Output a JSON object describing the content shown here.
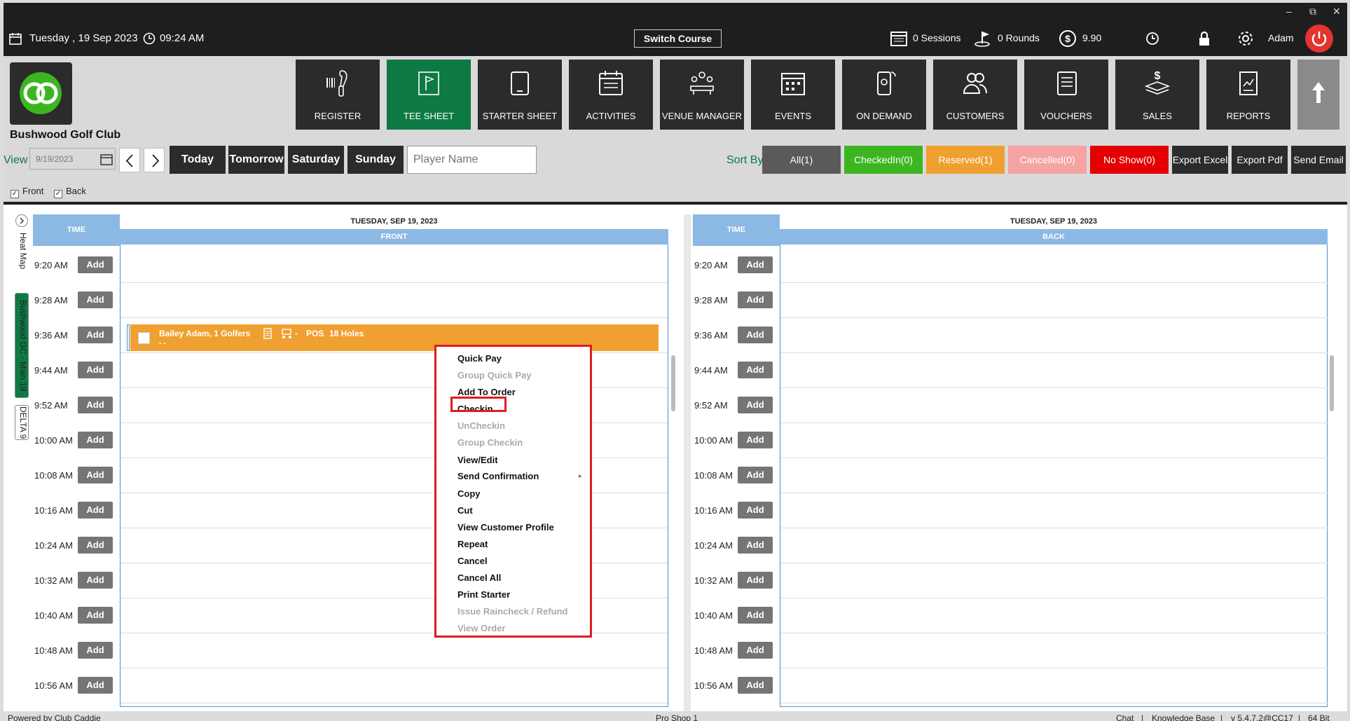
{
  "titlebar": {
    "date": "Tuesday ,  19 Sep 2023",
    "time": "09:24 AM",
    "switch_course": "Switch Course",
    "sessions": "0 Sessions",
    "rounds": "0 Rounds",
    "amount": "9.90",
    "user": "Adam",
    "win_min": "–",
    "win_max": "⧉",
    "win_close": "✕"
  },
  "club": {
    "name": "Bushwood Golf Club"
  },
  "nav": [
    {
      "label": "REGISTER",
      "icon": "barcode-scanner-icon"
    },
    {
      "label": "TEE SHEET",
      "icon": "flag-icon",
      "active": true
    },
    {
      "label": "STARTER SHEET",
      "icon": "tablet-icon"
    },
    {
      "label": "ACTIVITIES",
      "icon": "calendar-list-icon"
    },
    {
      "label": "VENUE MANAGER",
      "icon": "meeting-icon"
    },
    {
      "label": "EVENTS",
      "icon": "calendar-icon"
    },
    {
      "label": "ON DEMAND",
      "icon": "mobile-icon"
    },
    {
      "label": "CUSTOMERS",
      "icon": "people-icon"
    },
    {
      "label": "VOUCHERS",
      "icon": "voucher-icon"
    },
    {
      "label": "SALES",
      "icon": "money-icon"
    },
    {
      "label": "REPORTS",
      "icon": "report-icon"
    }
  ],
  "toolbar": {
    "view_label": "View",
    "date_value": "9/19/2023",
    "today": "Today",
    "tomorrow": "Tomorrow",
    "saturday": "Saturday",
    "sunday": "Sunday",
    "player_placeholder": "Player Name",
    "sort_by": "Sort By",
    "all": "All(1)",
    "checkedin": "CheckedIn(0)",
    "reserved": "Reserved(1)",
    "cancelled": "Cancelled(0)",
    "noshow": "No Show(0)",
    "export_excel": "Export Excel",
    "export_pdf": "Export Pdf",
    "send_email": "Send Email",
    "front": "Front",
    "back": "Back",
    "status_colors": {
      "all": "#5a5a5a",
      "checkedin": "#3cb521",
      "reserved": "#f0a030",
      "cancelled": "#f5a3a3",
      "noshow": "#e40000"
    }
  },
  "side_tabs": {
    "heat_map": "Heat Map",
    "course1": "Bushwood GC - Main 18",
    "course2": "DELTA 9"
  },
  "grid": {
    "time_header": "TIME",
    "date_header": "TUESDAY, SEP 19, 2023",
    "front": "FRONT",
    "back": "BACK",
    "add": "Add",
    "times": [
      "9:20 AM",
      "9:28 AM",
      "9:36 AM",
      "9:44 AM",
      "9:52 AM",
      "10:00 AM",
      "10:08 AM",
      "10:16 AM",
      "10:24 AM",
      "10:32 AM",
      "10:40 AM",
      "10:48 AM",
      "10:56 AM"
    ]
  },
  "booking": {
    "name": "Bailey Adam, 1 Golfers",
    "sep": "-",
    "pos": "POS",
    "holes": "18 Holes",
    "line2": "-  -"
  },
  "context_menu": [
    {
      "label": "Quick Pay",
      "enabled": true
    },
    {
      "label": "Group Quick Pay",
      "enabled": false
    },
    {
      "label": "Add To Order",
      "enabled": true
    },
    {
      "label": "Checkin",
      "enabled": true,
      "highlighted": true
    },
    {
      "label": "UnCheckin",
      "enabled": false
    },
    {
      "label": "Group Checkin",
      "enabled": false
    },
    {
      "label": "View/Edit",
      "enabled": true
    },
    {
      "label": "Send Confirmation",
      "enabled": true,
      "submenu": true
    },
    {
      "label": "Copy",
      "enabled": true
    },
    {
      "label": "Cut",
      "enabled": true
    },
    {
      "label": "View Customer Profile",
      "enabled": true
    },
    {
      "label": "Repeat",
      "enabled": true
    },
    {
      "label": "Cancel",
      "enabled": true
    },
    {
      "label": "Cancel All",
      "enabled": true
    },
    {
      "label": "Print Starter",
      "enabled": true
    },
    {
      "label": "Issue Raincheck / Refund",
      "enabled": false
    },
    {
      "label": "View Order",
      "enabled": false
    }
  ],
  "statusbar": {
    "powered": "Powered by Club Caddie",
    "shop": "Pro Shop 1",
    "chat": "Chat",
    "kb": "Knowledge Base",
    "version": "v 5.4.7.2@CC17",
    "bits": "64 Bit",
    "sep": "|"
  }
}
